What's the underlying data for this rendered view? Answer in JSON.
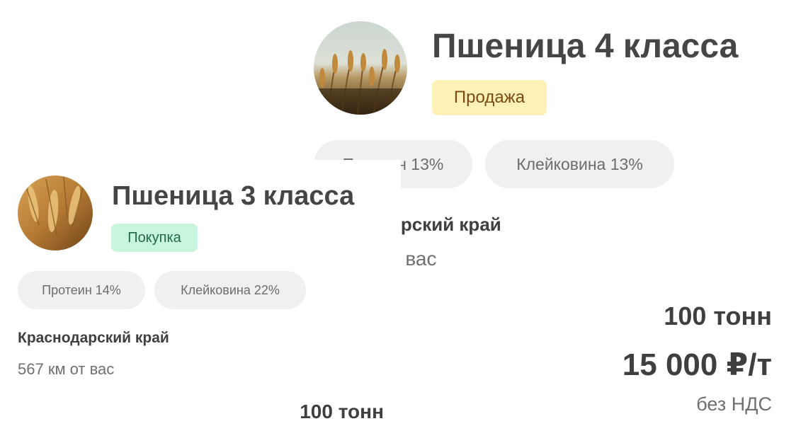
{
  "cards": [
    {
      "title": "Пшеница 4 класса",
      "badge": "Продажа",
      "chips": [
        "Протеин 13%",
        "Клейковина 13%"
      ],
      "region": "Краснодарский край",
      "distance": "567 км от вас",
      "volume": "100 тонн",
      "price": "15 000 ₽/т",
      "vat": "без НДС",
      "image": "wheat-field-photo"
    },
    {
      "title": "Пшеница 3 класса",
      "badge": "Покупка",
      "chips": [
        "Протеин 14%",
        "Клейковина 22%"
      ],
      "region": "Краснодарский край",
      "distance": "567 км от вас",
      "volume": "100 тонн",
      "image": "wheat-ears-photo"
    }
  ],
  "colors": {
    "sale_badge_bg": "#fdf1b8",
    "sale_badge_text": "#7a4a10",
    "buy_badge_bg": "#c8f5dd",
    "buy_badge_text": "#1f6a45",
    "chip_bg": "#eff0f2"
  }
}
